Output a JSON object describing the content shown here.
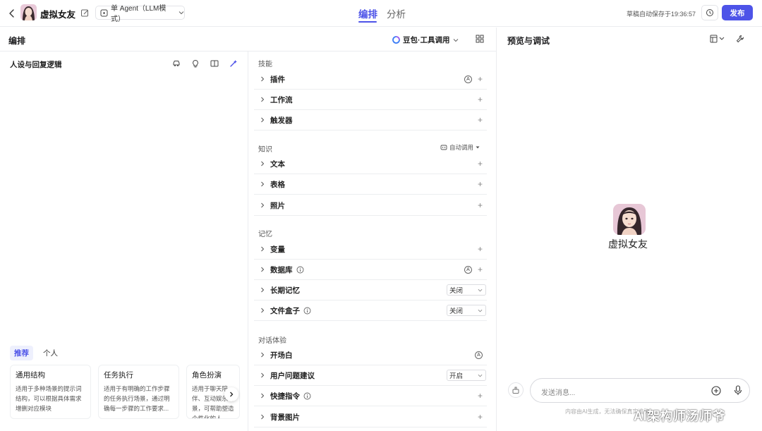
{
  "header": {
    "bot_name": "虚拟女友",
    "agent_mode": "单 Agent（LLM模式）",
    "tabs": [
      {
        "label": "编排",
        "active": true
      },
      {
        "label": "分析",
        "active": false
      }
    ],
    "autosave_text": "草稿自动保存于19:36:57",
    "publish_label": "发布"
  },
  "toolbar": {
    "title": "编排",
    "model": "豆包·工具调用"
  },
  "persona": {
    "title": "人设与回复逻辑",
    "template_tabs": [
      "推荐",
      "个人"
    ],
    "templates": [
      {
        "title": "通用结构",
        "desc": "适用于多种场景的提示词结构，可以根据具体需求增删对应模块"
      },
      {
        "title": "任务执行",
        "desc": "适用于有明确的工作步骤的任务执行场景，通过明确每一步骤的工作要求..."
      },
      {
        "title": "角色扮演",
        "desc": "适用于聊天陪伴、互动娱乐场景，可帮助塑造个性化的人..."
      }
    ]
  },
  "skills": {
    "title": "技能",
    "items": [
      "插件",
      "工作流",
      "触发器"
    ]
  },
  "knowledge": {
    "title": "知识",
    "auto_call": "自动调用",
    "items": [
      "文本",
      "表格",
      "照片"
    ]
  },
  "memory": {
    "title": "记忆",
    "items": [
      "变量",
      "数据库",
      "长期记忆",
      "文件盒子"
    ],
    "long_term_value": "关闭",
    "file_box_value": "关闭"
  },
  "dialog": {
    "title": "对话体验",
    "items": [
      "开场白",
      "用户问题建议",
      "快捷指令",
      "背景图片"
    ],
    "suggest_value": "开启"
  },
  "preview": {
    "title": "预览与调试",
    "bot_name": "虚拟女友",
    "input_placeholder": "发送消息...",
    "disclaimer": "内容由AI生成，无法确保真实准确",
    "watermark": "AI架构师汤师爷"
  },
  "colors": {
    "accent": "#4d53e8",
    "border": "#ebecef"
  }
}
